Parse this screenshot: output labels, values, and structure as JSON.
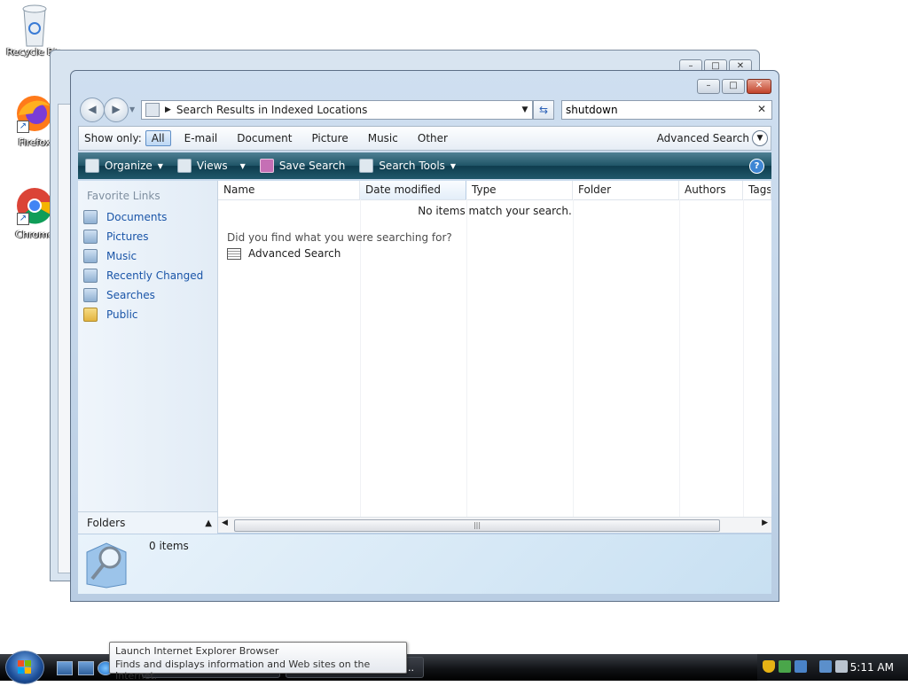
{
  "desktop": {
    "icons": [
      {
        "label": "Recycle Bin"
      },
      {
        "label": "Firefox"
      },
      {
        "label": "Chrome"
      }
    ]
  },
  "window": {
    "address": "Search Results in Indexed Locations",
    "search_value": "shutdown",
    "filter": {
      "label": "Show only:",
      "options": [
        "All",
        "E-mail",
        "Document",
        "Picture",
        "Music",
        "Other"
      ],
      "active": "All",
      "advanced": "Advanced Search"
    },
    "toolbar": {
      "organize": "Organize",
      "views": "Views",
      "save_search": "Save Search",
      "search_tools": "Search Tools"
    },
    "left_pane": {
      "header": "Favorite Links",
      "links": [
        "Documents",
        "Pictures",
        "Music",
        "Recently Changed",
        "Searches",
        "Public"
      ],
      "folders": "Folders"
    },
    "columns": [
      "Name",
      "Date modified",
      "Type",
      "Folder",
      "Authors",
      "Tags"
    ],
    "sorted_column": "Date modified",
    "empty_message": "No items match your search.",
    "prompt": "Did you find what you were searching for?",
    "advanced_link": "Advanced Search",
    "details": {
      "count": "0 items"
    }
  },
  "tooltip": {
    "title": "Launch Internet Explorer Browser",
    "description": "Finds and displays information and Web sites on the Internet."
  },
  "taskbar": {
    "clock": "5:11 AM",
    "button_text": "..."
  },
  "colors": {
    "toolbar": "#1f5567",
    "link": "#1a55a8",
    "close": "#c2432a"
  }
}
